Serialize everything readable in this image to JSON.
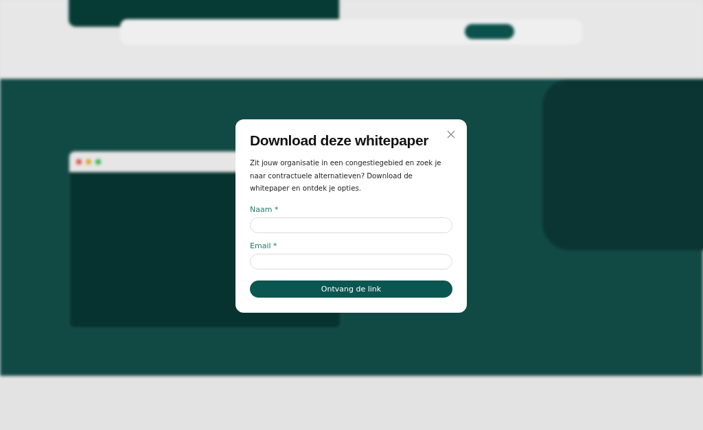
{
  "dialog": {
    "title": "Download deze whitepaper",
    "intro": "Zit jouw organisatie in een congestiegebied en zoek je naar contractuele alternatieven? Download de whitepaper en ontdek je opties.",
    "fields": [
      {
        "label": "Naam *"
      },
      {
        "label": "Email *"
      }
    ],
    "submit": "Ontvang de link"
  }
}
